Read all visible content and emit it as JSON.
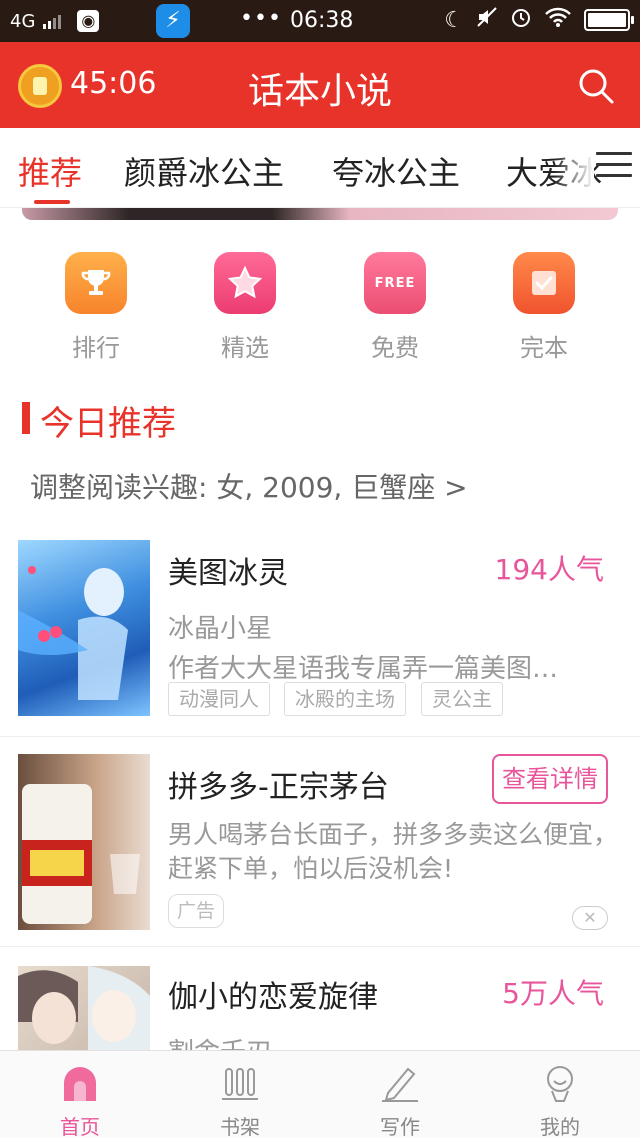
{
  "status_bar": {
    "network": "4G",
    "time": "06:38",
    "overflow": "•••"
  },
  "header": {
    "timer": "45:06",
    "title": "话本小说",
    "accent_color": "#e8332a"
  },
  "tabs": {
    "items": [
      {
        "label": "推荐",
        "active": true
      },
      {
        "label": "颜爵冰公主",
        "active": false
      },
      {
        "label": "夸冰公主",
        "active": false
      },
      {
        "label": "大爱冰",
        "active": false
      }
    ]
  },
  "quick_entries": [
    {
      "label": "排行",
      "icon": "trophy-icon",
      "color": "#f7953b"
    },
    {
      "label": "精选",
      "icon": "star-icon",
      "color": "#f0487a"
    },
    {
      "label": "免费",
      "icon": "free-icon",
      "color": "#f0587e",
      "badge": "FREE"
    },
    {
      "label": "完本",
      "icon": "check-icon",
      "color": "#f46a3e"
    }
  ],
  "section": {
    "title": "今日推荐",
    "interest": "调整阅读兴趣: 女, 2009, 巨蟹座 >"
  },
  "books": [
    {
      "title": "美图冰灵",
      "popularity": "194人气",
      "author": "冰晶小星",
      "description": "作者大大星语我专属弄一篇美图…",
      "tags": [
        "动漫同人",
        "冰殿的主场",
        "灵公主"
      ]
    }
  ],
  "ad": {
    "title": "拼多多-正宗茅台",
    "button": "查看详情",
    "description": "男人喝茅台长面子，拼多多卖这么便宜，赶紧下单，怕以后没机会!",
    "tag": "广告",
    "close": "✕"
  },
  "books_more": [
    {
      "title": "伽小的恋爱旋律",
      "popularity": "5万人气",
      "author": "割舍千刃"
    }
  ],
  "bottom_nav": [
    {
      "label": "首页",
      "icon": "home-icon",
      "active": true
    },
    {
      "label": "书架",
      "icon": "bookshelf-icon",
      "active": false
    },
    {
      "label": "写作",
      "icon": "pen-icon",
      "active": false
    },
    {
      "label": "我的",
      "icon": "profile-icon",
      "active": false
    }
  ]
}
